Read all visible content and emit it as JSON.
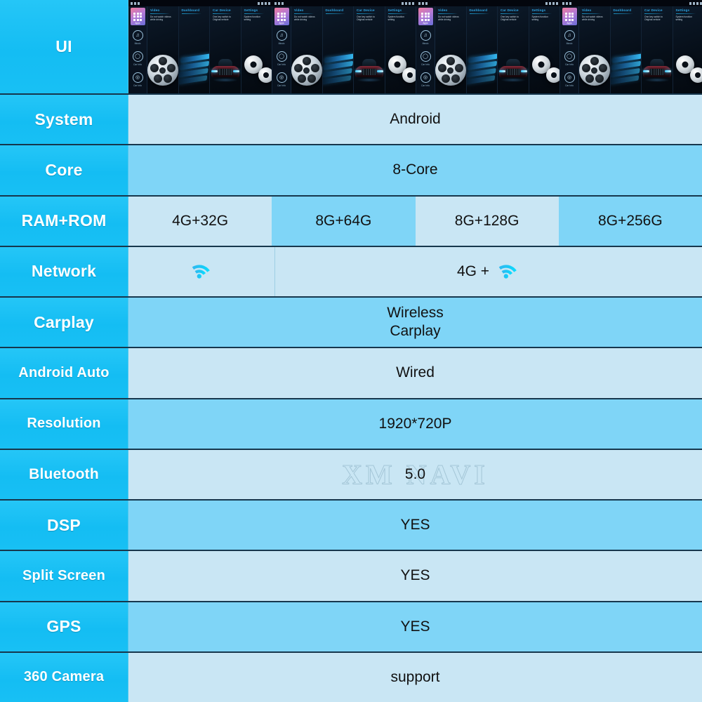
{
  "watermark": "XM NAVI",
  "colors": {
    "label_bg": "#19c2f5",
    "label_text": "#ffffff",
    "value_light": "#c9e6f4",
    "value_mid": "#7fd5f7",
    "border": "#16374d",
    "ui_accent": "#2fa8e8"
  },
  "rows": [
    {
      "label": "UI",
      "kind": "ui-strip",
      "cells": []
    },
    {
      "label": "System",
      "kind": "text",
      "tone": "light",
      "cells": [
        {
          "value": "Android"
        }
      ]
    },
    {
      "label": "Core",
      "kind": "text",
      "tone": "mid",
      "cells": [
        {
          "value": "8-Core"
        }
      ]
    },
    {
      "label": "RAM+ROM",
      "kind": "text",
      "tone": "alt",
      "cells": [
        {
          "value": "4G+32G"
        },
        {
          "value": "8G+64G"
        },
        {
          "value": "8G+128G"
        },
        {
          "value": "8G+256G"
        }
      ]
    },
    {
      "label": "Network",
      "kind": "network",
      "tone": "light",
      "cells": [
        {
          "value": "",
          "icon": "wifi-icon"
        },
        {
          "value": "4G +",
          "icon": "wifi-icon"
        }
      ]
    },
    {
      "label": "Carplay",
      "kind": "text",
      "tone": "mid",
      "cells": [
        {
          "value": "Wireless",
          "value2": "Carplay"
        }
      ]
    },
    {
      "label": "Android Auto",
      "kind": "text",
      "tone": "light",
      "cells": [
        {
          "value": "Wired"
        }
      ]
    },
    {
      "label": "Resolution",
      "kind": "text",
      "tone": "mid",
      "cells": [
        {
          "value": "1920*720P"
        }
      ]
    },
    {
      "label": "Bluetooth",
      "kind": "text",
      "tone": "light",
      "watermark": true,
      "cells": [
        {
          "value": "5.0"
        }
      ]
    },
    {
      "label": "DSP",
      "kind": "text",
      "tone": "mid",
      "cells": [
        {
          "value": "YES"
        }
      ]
    },
    {
      "label": "Split Screen",
      "kind": "text",
      "tone": "light",
      "cells": [
        {
          "value": "YES"
        }
      ]
    },
    {
      "label": "GPS",
      "kind": "text",
      "tone": "mid",
      "cells": [
        {
          "value": "YES"
        }
      ]
    },
    {
      "label": "360 Camera",
      "kind": "text",
      "tone": "light",
      "cells": [
        {
          "value": "support"
        }
      ]
    }
  ],
  "ui_strip": {
    "status_bar": {
      "left_text": "",
      "right_text": ""
    },
    "sidebar": {
      "tile_label": "Apps",
      "items": [
        {
          "label": "Apps",
          "icon": "apps-icon"
        },
        {
          "label": "Music",
          "icon": "music-note-icon"
        },
        {
          "label": "Car Info",
          "icon": "car-info-icon"
        }
      ]
    },
    "panels": [
      {
        "title": "Video",
        "desc": "Do not watch videos while driving",
        "art": "film-reel-icon"
      },
      {
        "title": "Dashboard",
        "desc": "",
        "art": "curved-screen-icon"
      },
      {
        "title": "Car Device",
        "desc": "One key switch to Original vehicle",
        "art": "car-icon"
      },
      {
        "title": "Settings",
        "desc": "System function setting",
        "art": "gears-icon"
      }
    ],
    "repeat_count": 5
  }
}
